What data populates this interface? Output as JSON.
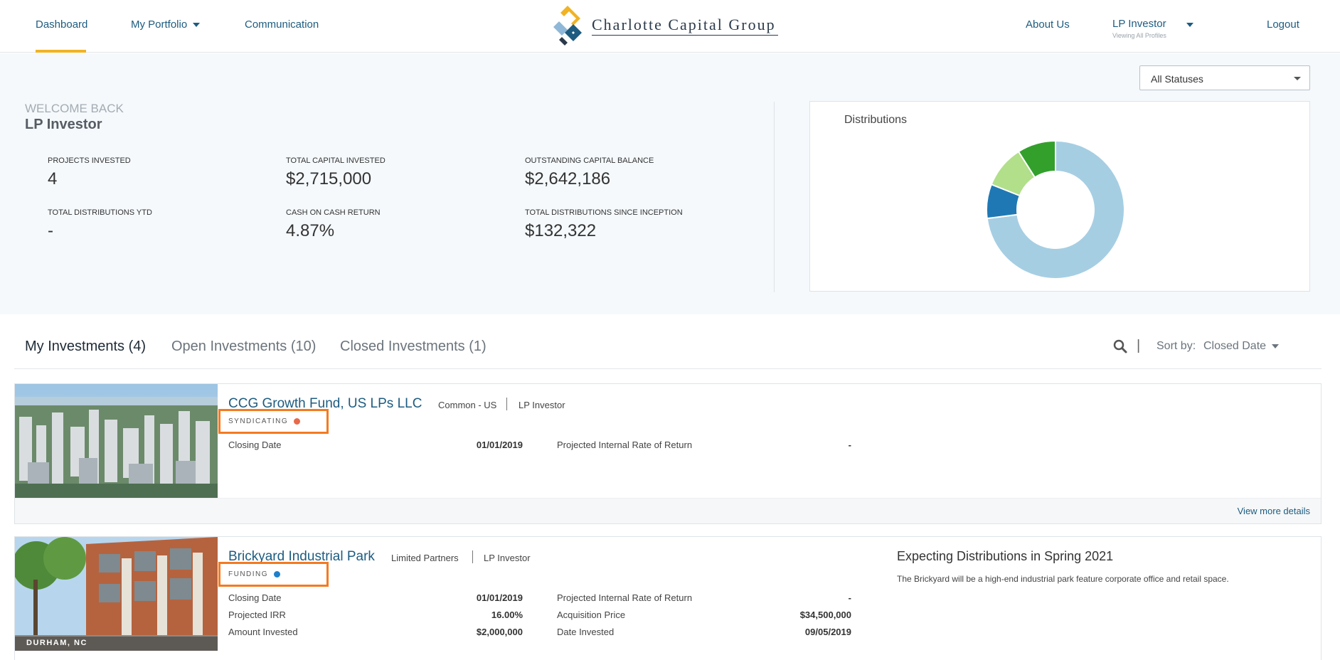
{
  "nav": {
    "dashboard": "Dashboard",
    "portfolio": "My Portfolio",
    "communication": "Communication",
    "logo_text": "Charlotte Capital Group",
    "about": "About Us",
    "user": "LP Investor",
    "user_sub": "Viewing All Profiles",
    "logout": "Logout"
  },
  "filter": {
    "status": "All Statuses"
  },
  "welcome": {
    "greeting": "WELCOME BACK",
    "name": "LP Investor"
  },
  "stats": [
    {
      "label": "PROJECTS INVESTED",
      "value": "4"
    },
    {
      "label": "TOTAL CAPITAL INVESTED",
      "value": "$2,715,000"
    },
    {
      "label": "OUTSTANDING CAPITAL BALANCE",
      "value": "$2,642,186"
    },
    {
      "label": "TOTAL DISTRIBUTIONS YTD",
      "value": "-"
    },
    {
      "label": "CASH ON CASH RETURN",
      "value": "4.87%"
    },
    {
      "label": "TOTAL DISTRIBUTIONS SINCE INCEPTION",
      "value": "$132,322"
    }
  ],
  "distributions": {
    "title": "Distributions",
    "chart_data": {
      "type": "pie",
      "title": "Distributions",
      "slices": [
        {
          "value": 73,
          "color": "#a6cee3"
        },
        {
          "value": 8,
          "color": "#1f78b4"
        },
        {
          "value": 10,
          "color": "#b2df8a"
        },
        {
          "value": 9,
          "color": "#33a02c"
        }
      ]
    }
  },
  "tabs": {
    "mine": "My Investments (4)",
    "open": "Open Investments (10)",
    "closed": "Closed Investments (1)",
    "pipe": "|",
    "sort_label": "Sort by:",
    "sort_value": "Closed Date"
  },
  "investments": [
    {
      "name": "CCG Growth Fund, US LPs LLC",
      "class": "Common - US",
      "role": "LP Investor",
      "status": "SYNDICATING",
      "status_color": "#e8694a",
      "closing_label": "Closing Date",
      "closing_value": "01/01/2019",
      "irr_label": "Projected Internal Rate of Return",
      "irr_value": "-",
      "more": "View more details"
    },
    {
      "name": "Brickyard Industrial Park",
      "class": "Limited Partners",
      "role": "LP Investor",
      "status": "FUNDING",
      "status_color": "#1f7fc9",
      "location": "DURHAM, NC",
      "rows": [
        {
          "label": "Closing Date",
          "value": "01/01/2019",
          "label2": "Projected Internal Rate of Return",
          "value2": "-"
        },
        {
          "label": "Projected IRR",
          "value": "16.00%",
          "label2": "Acquisition Price",
          "value2": "$34,500,000"
        },
        {
          "label": "Amount Invested",
          "value": "$2,000,000",
          "label2": "Date Invested",
          "value2": "09/05/2019"
        }
      ],
      "expect_title": "Expecting Distributions in Spring 2021",
      "expect_text": "The Brickyard will be a high-end industrial park feature corporate office and retail space."
    }
  ]
}
